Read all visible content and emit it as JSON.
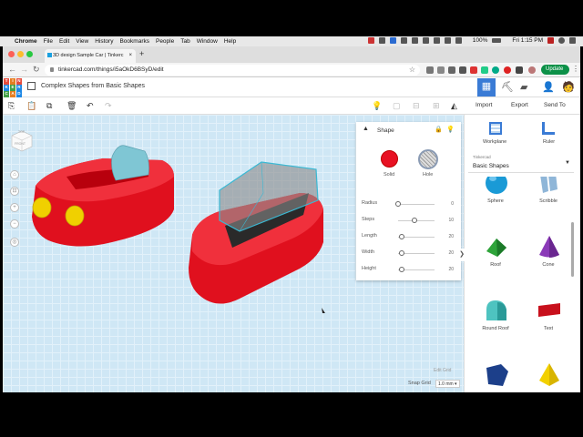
{
  "mac": {
    "apple": "",
    "app": "Chrome",
    "menus": [
      "File",
      "Edit",
      "View",
      "History",
      "Bookmarks",
      "People",
      "Tab",
      "Window",
      "Help"
    ],
    "battery": "100%",
    "clock": "Fri 1:15 PM"
  },
  "browser": {
    "tab_title": "3D design Sample Car | Tinkerc",
    "tab_close": "×",
    "newtab": "+",
    "url": "tinkercad.com/things/i5aOkD6BSyD/edit",
    "update_label": "Update",
    "menu_dots": "⋮",
    "back": "←",
    "forward": "→",
    "reload": "↻"
  },
  "tc": {
    "logo_letters": [
      "TIN",
      "KER",
      "CAD"
    ],
    "project_title": "Complex Shapes from Basic Shapes",
    "import": "Import",
    "export": "Export",
    "send_to": "Send To"
  },
  "shape_panel": {
    "title": "Shape",
    "solid": "Solid",
    "hole": "Hole",
    "props": [
      {
        "label": "Radius",
        "value": "0",
        "level": 0
      },
      {
        "label": "Steps",
        "value": "10",
        "level": 0.45
      },
      {
        "label": "Length",
        "value": "20",
        "level": 0.1
      },
      {
        "label": "Width",
        "value": "20",
        "level": 0.1
      },
      {
        "label": "Height",
        "value": "20",
        "level": 0.1
      }
    ]
  },
  "workplane": {
    "edit_grid": "Edit Grid",
    "snap_grid": "Snap Grid",
    "snap_value": "1.0 mm ▾",
    "viewcube_top": "TOP",
    "viewcube_front": "FRONT"
  },
  "right_panel": {
    "workplane": "Workplane",
    "ruler": "Ruler",
    "library_small": "Tinkercad",
    "library": "Basic Shapes",
    "expander": "❯",
    "shapes": [
      "Sphere",
      "Scribble",
      "Roof",
      "Cone",
      "Round Roof",
      "Text",
      "",
      ""
    ]
  },
  "colors": {
    "accent": "#3a7bd5",
    "car_red": "#e0101e",
    "wheel_yellow": "#f0d000",
    "grid_bg": "#cfe7f5"
  }
}
